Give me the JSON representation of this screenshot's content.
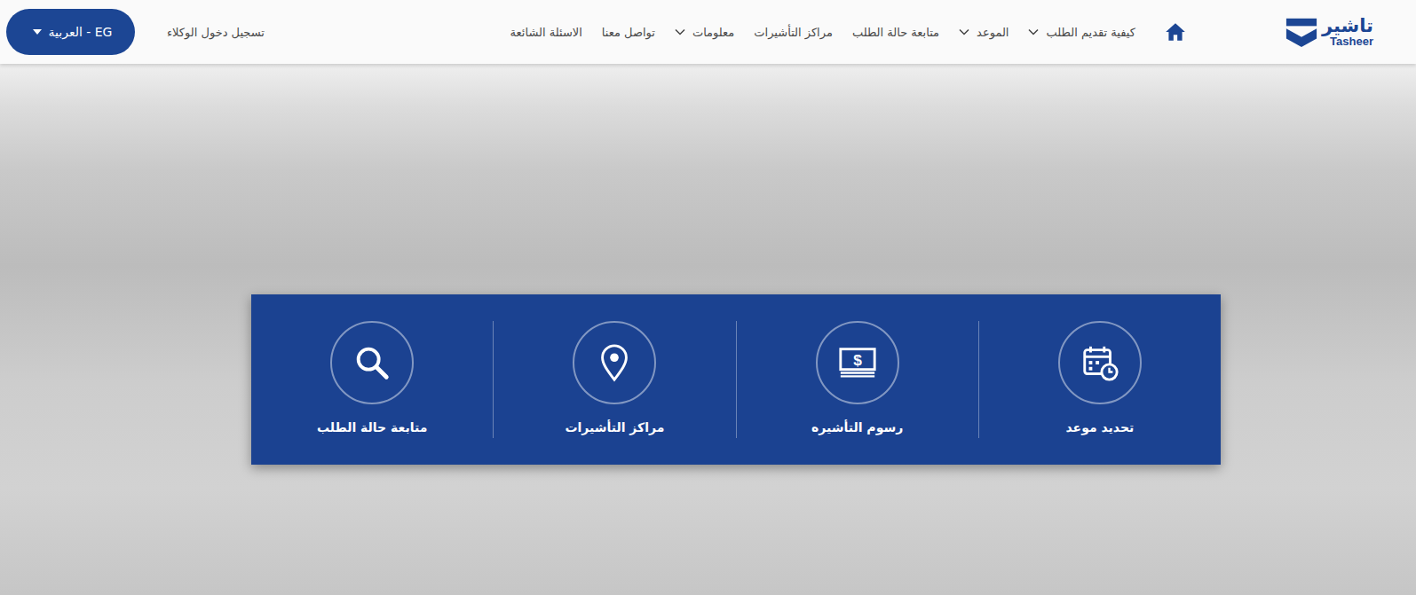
{
  "logo": {
    "arabic": "تاشير",
    "latin": "Tasheer"
  },
  "nav": {
    "items": [
      {
        "label": "كيفية تقديم الطلب",
        "dropdown": true
      },
      {
        "label": "الموعد",
        "dropdown": true
      },
      {
        "label": "متابعة حالة الطلب",
        "dropdown": false
      },
      {
        "label": "مراكز التأشيرات",
        "dropdown": false
      },
      {
        "label": "معلومات",
        "dropdown": true
      },
      {
        "label": "تواصل معنا",
        "dropdown": false
      },
      {
        "label": "الاسئلة الشائعة",
        "dropdown": false
      }
    ]
  },
  "agentLogin": "تسجيل دخول الوكلاء",
  "language": {
    "label": "EG - العربية"
  },
  "hero": {
    "tiles": [
      {
        "label": "تحديد موعد",
        "kind": "calendar",
        "glyph": null
      },
      {
        "label": "رسوم التأشيره",
        "kind": "money",
        "glyph": "$"
      },
      {
        "label": "مراكز التأشيرات",
        "kind": "pin",
        "glyph": null
      },
      {
        "label": "متابعة حالة الطلب",
        "kind": "search",
        "glyph": null
      }
    ]
  }
}
